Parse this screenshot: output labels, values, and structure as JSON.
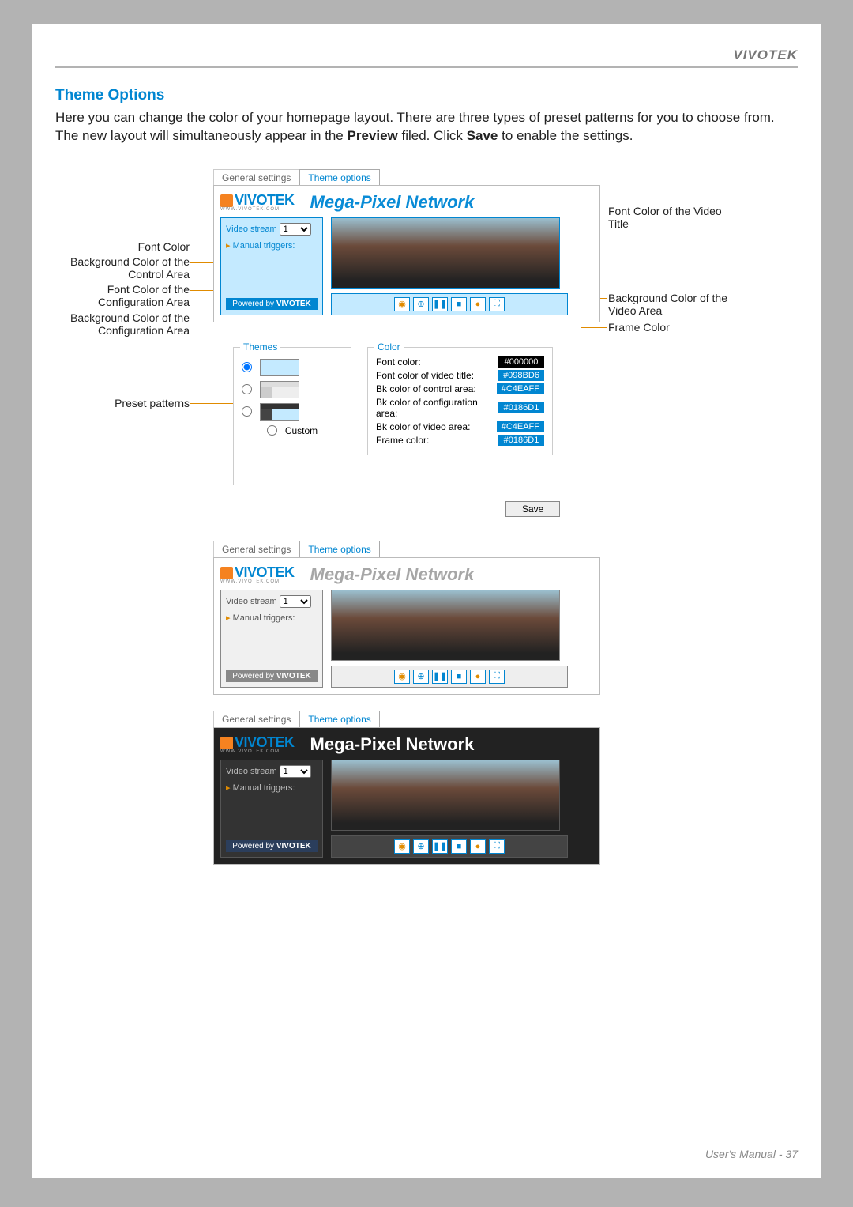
{
  "brand": "VIVOTEK",
  "section_title": "Theme Options",
  "intro_a": "Here you can change the color of your homepage layout. There are three types of preset patterns for you to choose from. The new layout will simultaneously appear in the ",
  "intro_b": "Preview",
  "intro_c": " filed. Click ",
  "intro_d": "Save",
  "intro_e": " to enable the settings.",
  "tabs": {
    "general": "General settings",
    "theme": "Theme options"
  },
  "logo": "VIVOTEK",
  "logo_sub": "WWW.VIVOTEK.COM",
  "video_title": "Mega-Pixel Network",
  "sidebar": {
    "stream_label": "Video stream",
    "stream_value": "1",
    "manual_triggers": "Manual triggers:",
    "powered": "Powered by"
  },
  "callouts": {
    "font_color": "Font Color",
    "bg_control": "Background Color of the Control Area",
    "fc_config": "Font Color of the Configuration Area",
    "bg_config": "Background Color of the Configuration Area",
    "preset": "Preset patterns",
    "fc_title": "Font Color of the Video Title",
    "bg_video": "Background Color of the Video Area",
    "frame": "Frame Color"
  },
  "themes_label": "Themes",
  "custom_label": "Custom",
  "color_label": "Color",
  "colors": {
    "font": {
      "label": "Font color:",
      "value": "#000000"
    },
    "title": {
      "label": "Font color of video title:",
      "value": "#098BD6"
    },
    "control": {
      "label": "Bk color of control area:",
      "value": "#C4EAFF"
    },
    "config": {
      "label": "Bk color of configuration area:",
      "value": "#0186D1"
    },
    "video": {
      "label": "Bk color of video area:",
      "value": "#C4EAFF"
    },
    "frame": {
      "label": "Frame color:",
      "value": "#0186D1"
    }
  },
  "save": "Save",
  "footer": "User's Manual - 37"
}
